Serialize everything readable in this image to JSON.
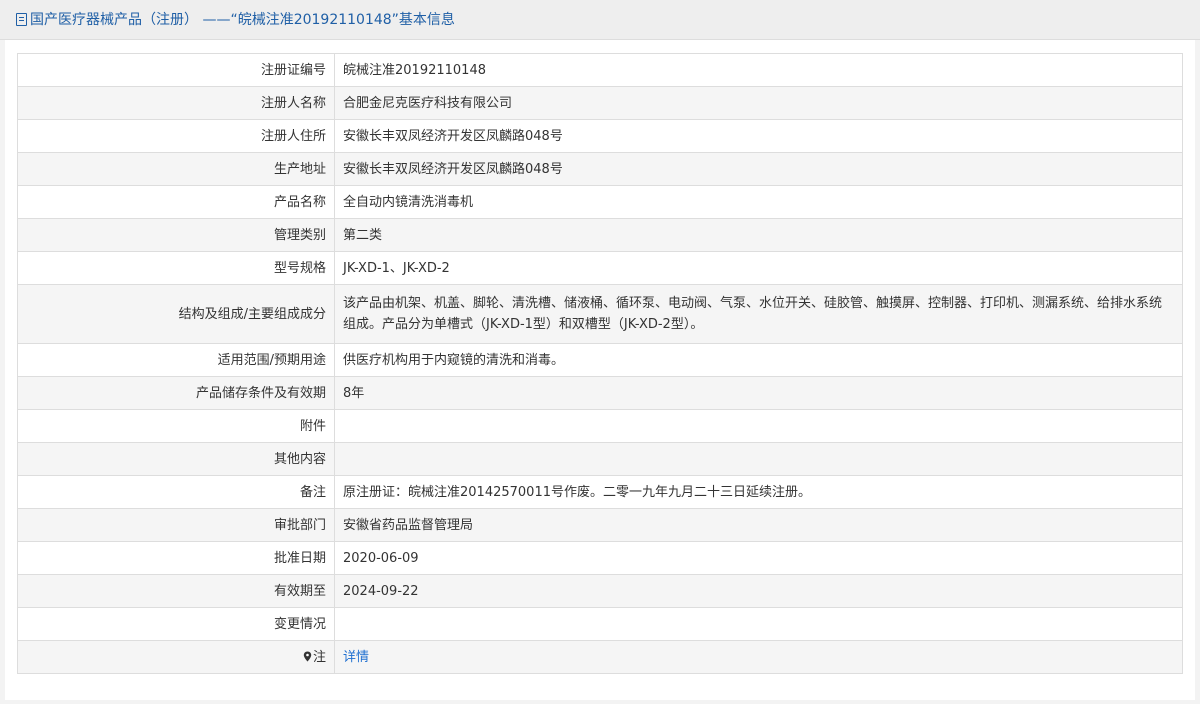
{
  "header": {
    "title": "国产医疗器械产品（注册） ——“皖械注准20192110148”基本信息"
  },
  "rows": [
    {
      "label": "注册证编号",
      "value": "皖械注准20192110148"
    },
    {
      "label": "注册人名称",
      "value": "合肥金尼克医疗科技有限公司"
    },
    {
      "label": "注册人住所",
      "value": "安徽长丰双凤经济开发区凤麟路048号"
    },
    {
      "label": "生产地址",
      "value": "安徽长丰双凤经济开发区凤麟路048号"
    },
    {
      "label": "产品名称",
      "value": "全自动内镜清洗消毒机"
    },
    {
      "label": "管理类别",
      "value": "第二类"
    },
    {
      "label": "型号规格",
      "value": "JK-XD-1、JK-XD-2"
    },
    {
      "label": "结构及组成/主要组成成分",
      "value": "该产品由机架、机盖、脚轮、清洗槽、储液桶、循环泵、电动阀、气泵、水位开关、硅胶管、触摸屏、控制器、打印机、测漏系统、给排水系统组成。产品分为单槽式（JK-XD-1型）和双槽型（JK-XD-2型）。"
    },
    {
      "label": "适用范围/预期用途",
      "value": "供医疗机构用于内窥镜的清洗和消毒。"
    },
    {
      "label": "产品储存条件及有效期",
      "value": "8年"
    },
    {
      "label": "附件",
      "value": ""
    },
    {
      "label": "其他内容",
      "value": ""
    },
    {
      "label": "备注",
      "value": "原注册证：皖械注准20142570011号作废。二零一九年九月二十三日延续注册。"
    },
    {
      "label": "审批部门",
      "value": "安徽省药品监督管理局"
    },
    {
      "label": "批准日期",
      "value": "2020-06-09"
    },
    {
      "label": "有效期至",
      "value": "2024-09-22"
    },
    {
      "label": "变更情况",
      "value": ""
    },
    {
      "label": "注",
      "value": "详情"
    }
  ],
  "icons": {
    "header": "document-icon",
    "note": "map-pin-icon"
  },
  "colors": {
    "title": "#1f5fa6",
    "link": "#1f6fd0",
    "border": "#dddddd",
    "row_alt": "#f5f5f5"
  }
}
